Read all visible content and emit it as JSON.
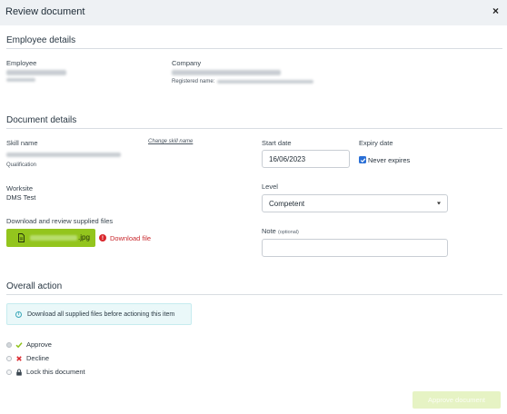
{
  "dialog": {
    "title": "Review document",
    "close_glyph": "×"
  },
  "employee_section": {
    "title": "Employee details",
    "employee_label": "Employee",
    "company_label": "Company",
    "registered_name_label": "Registered name:"
  },
  "document_section": {
    "title": "Document details",
    "skill_name_label": "Skill name",
    "change_skill_link": "Change skill name",
    "qualification_label": "Qualification",
    "worksite_label": "Worksite",
    "worksite_value": "DMS Test",
    "download_files_label": "Download and review supplied files",
    "file_extension": ".jpg",
    "download_file_link": "Download file",
    "start_date_label": "Start date",
    "start_date_value": "16/06/2023",
    "expiry_date_label": "Expiry date",
    "never_expires_label": "Never expires",
    "never_expires_checked": true,
    "level_label": "Level",
    "level_value": "Competent",
    "note_label": "Note",
    "note_optional": "(optional)",
    "note_value": ""
  },
  "overall_section": {
    "title": "Overall action",
    "alert_text": "Download all supplied files before actioning this item",
    "options": [
      {
        "label": "Approve",
        "icon": "check-icon",
        "selected": true
      },
      {
        "label": "Decline",
        "icon": "x-icon",
        "selected": false
      },
      {
        "label": "Lock this document",
        "icon": "lock-icon",
        "selected": false
      }
    ],
    "approve_button": "Approve document"
  },
  "colors": {
    "header_bg": "#eef1f4",
    "file_button": "#93c51d",
    "error_red": "#c92a2f",
    "checkbox_blue": "#2a6fd6",
    "approve_disabled": "#e6f3c4",
    "alert_bg": "#eaf8f9"
  }
}
